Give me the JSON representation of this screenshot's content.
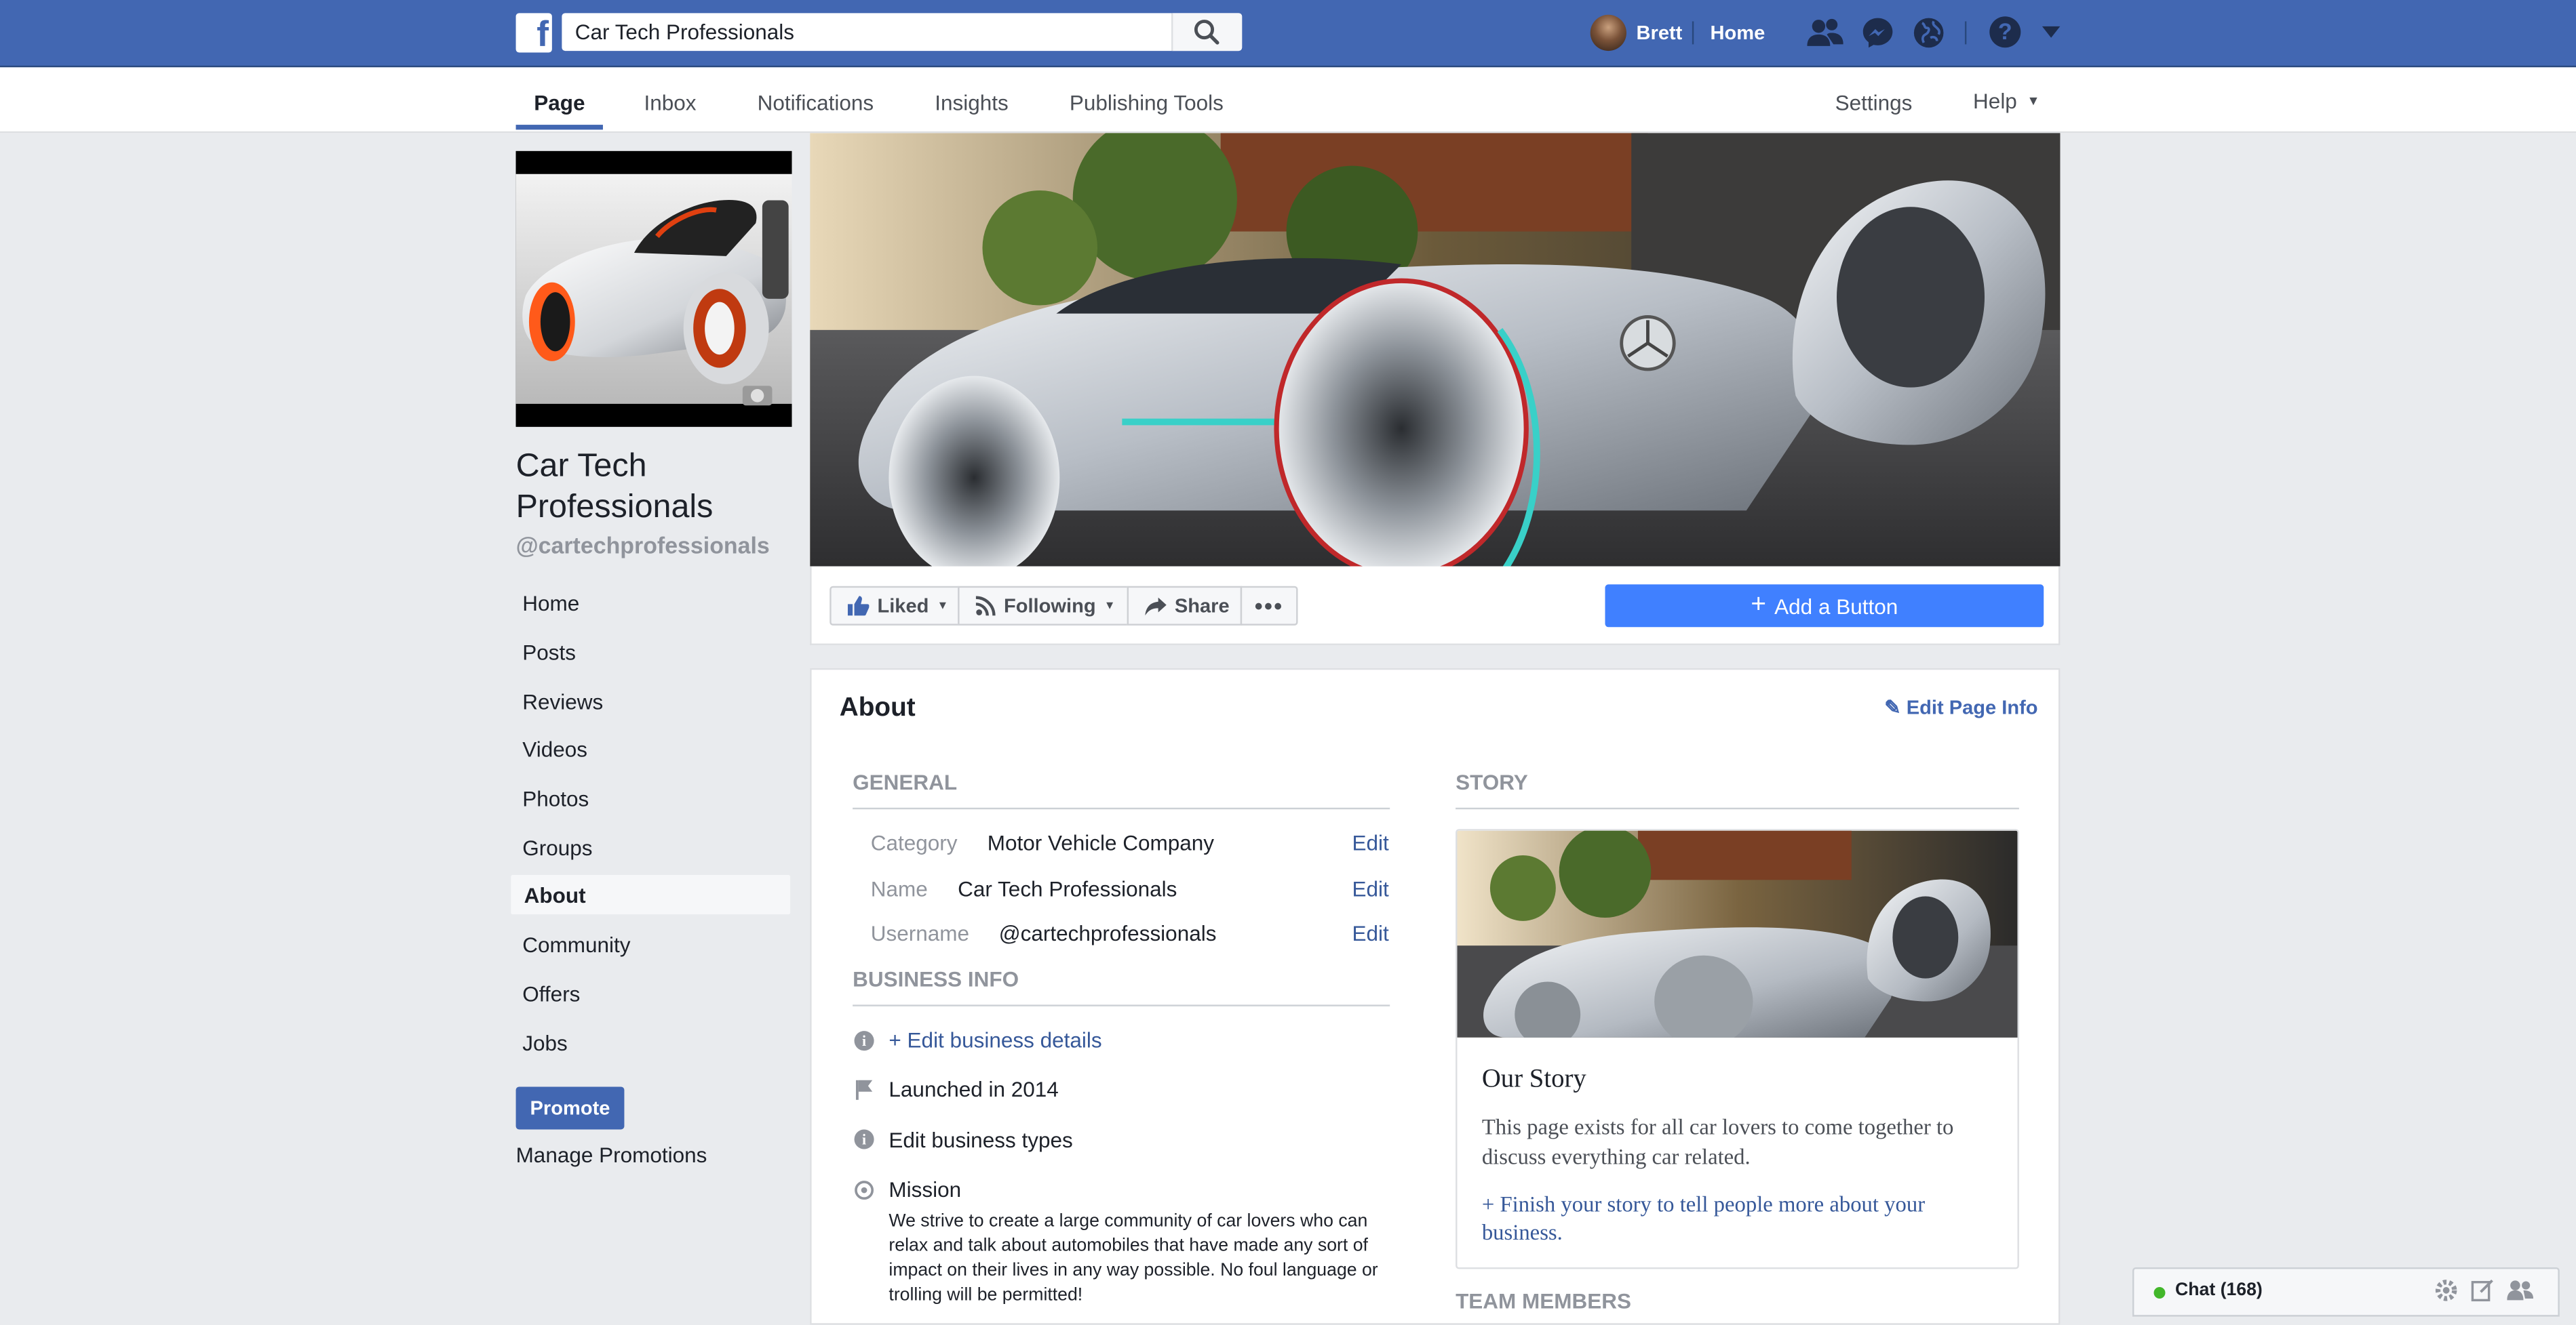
{
  "topbar": {
    "search_value": "Car Tech Professionals",
    "search_placeholder": "Search",
    "user_name": "Brett",
    "home_label": "Home",
    "brand_color": "#4267b2"
  },
  "page_tabs": {
    "items": [
      "Page",
      "Inbox",
      "Notifications",
      "Insights",
      "Publishing Tools"
    ],
    "settings_label": "Settings",
    "help_label": "Help"
  },
  "sidebar": {
    "page_name_line1": "Car Tech",
    "page_name_line2": "Professionals",
    "username": "@cartechprofessionals",
    "nav": [
      "Home",
      "Posts",
      "Reviews",
      "Videos",
      "Photos",
      "Groups",
      "About",
      "Community",
      "Offers",
      "Jobs"
    ],
    "active_nav": "About",
    "promote_label": "Promote",
    "manage_promotions_label": "Manage Promotions"
  },
  "actions": {
    "liked_label": "Liked",
    "following_label": "Following",
    "share_label": "Share",
    "add_button_label": "Add a Button"
  },
  "about": {
    "title": "About",
    "edit_page_info_label": "Edit Page Info",
    "general_heading": "GENERAL",
    "category_label": "Category",
    "category_value": "Motor Vehicle Company",
    "name_label": "Name",
    "name_value": "Car Tech Professionals",
    "username_label": "Username",
    "username_value": "@cartechprofessionals",
    "edit_label": "Edit",
    "business_heading": "BUSINESS INFO",
    "edit_business_details": "+ Edit business details",
    "launched": "Launched in 2014",
    "edit_business_types": "Edit business types",
    "mission_label": "Mission",
    "mission_text": "We strive to create a large community of car lovers who can relax and talk about automobiles that have made any sort of impact on their lives in any way possible. No foul language or trolling will be permitted!",
    "story_heading": "STORY",
    "story_title": "Our Story",
    "story_text": "This page exists for all car lovers to come together to discuss everything car related.",
    "story_link": "+ Finish your story to tell people more about your business.",
    "team_heading": "TEAM MEMBERS"
  },
  "chat": {
    "label": "Chat (168)",
    "status_color": "#42b72a"
  }
}
